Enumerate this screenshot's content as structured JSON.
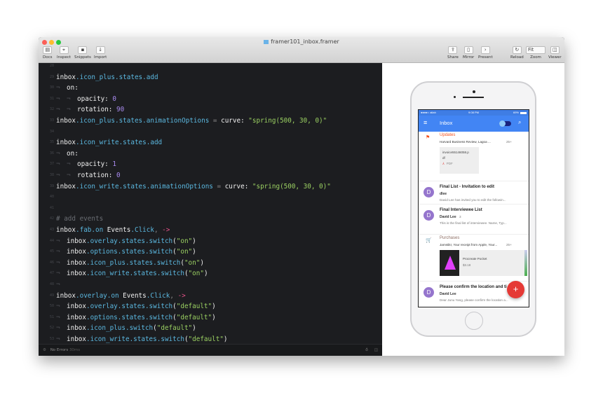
{
  "window": {
    "title": "framer101_inbox.framer"
  },
  "toolbar": {
    "left": [
      {
        "label": "Docs",
        "icon": "book-icon",
        "glyph": "▤"
      },
      {
        "label": "Inspect",
        "icon": "crosshair-icon",
        "glyph": "⌖"
      },
      {
        "label": "Snippets",
        "icon": "snippet-icon",
        "glyph": "▪"
      },
      {
        "label": "Import",
        "icon": "import-icon",
        "glyph": "↓"
      }
    ],
    "right": [
      {
        "label": "Share",
        "icon": "share-icon",
        "glyph": "⇪"
      },
      {
        "label": "Mirror",
        "icon": "mirror-icon",
        "glyph": "▯"
      },
      {
        "label": "Present",
        "icon": "present-icon",
        "glyph": "›"
      }
    ],
    "far": [
      {
        "label": "Reload",
        "icon": "reload-icon",
        "glyph": "↻"
      },
      {
        "label": "Zoom",
        "value": "Fit",
        "icon": "chevron-down-icon"
      },
      {
        "label": "Viewer",
        "icon": "viewer-icon",
        "glyph": "◫"
      }
    ]
  },
  "code": {
    "tab_glyph": "¬",
    "lines": [
      {
        "n": "28",
        "indent": 0,
        "t": []
      },
      {
        "n": "29",
        "indent": 0,
        "t": [
          [
            "inbox",
            "w"
          ],
          [
            ".icon_plus.states.add",
            "p"
          ]
        ]
      },
      {
        "n": "30",
        "indent": 1,
        "t": [
          [
            "on:",
            "w"
          ]
        ]
      },
      {
        "n": "31",
        "indent": 2,
        "t": [
          [
            "opacity: ",
            "w"
          ],
          [
            "0",
            "n"
          ]
        ]
      },
      {
        "n": "32",
        "indent": 2,
        "t": [
          [
            "rotation: ",
            "w"
          ],
          [
            "90",
            "n"
          ]
        ]
      },
      {
        "n": "33",
        "indent": 0,
        "t": [
          [
            "inbox",
            "w"
          ],
          [
            ".icon_plus.states.animationOptions",
            "p"
          ],
          [
            " = ",
            "o"
          ],
          [
            "curve: ",
            "w"
          ],
          [
            "\"spring(500, 30, 0)\"",
            "s"
          ]
        ]
      },
      {
        "n": "34",
        "indent": 0,
        "t": []
      },
      {
        "n": "35",
        "indent": 0,
        "t": [
          [
            "inbox",
            "w"
          ],
          [
            ".icon_write.states.add",
            "p"
          ]
        ]
      },
      {
        "n": "36",
        "indent": 1,
        "t": [
          [
            "on:",
            "w"
          ]
        ]
      },
      {
        "n": "37",
        "indent": 2,
        "t": [
          [
            "opacity: ",
            "w"
          ],
          [
            "1",
            "n"
          ]
        ]
      },
      {
        "n": "38",
        "indent": 2,
        "t": [
          [
            "rotation: ",
            "w"
          ],
          [
            "0",
            "n"
          ]
        ]
      },
      {
        "n": "39",
        "indent": 0,
        "t": [
          [
            "inbox",
            "w"
          ],
          [
            ".icon_write.states.animationOptions",
            "p"
          ],
          [
            " = ",
            "o"
          ],
          [
            "curve: ",
            "w"
          ],
          [
            "\"spring(500, 30, 0)\"",
            "s"
          ]
        ]
      },
      {
        "n": "40",
        "indent": 0,
        "t": []
      },
      {
        "n": "41",
        "indent": 0,
        "t": []
      },
      {
        "n": "42",
        "indent": 0,
        "t": [
          [
            "# add events",
            "c"
          ]
        ]
      },
      {
        "n": "43",
        "indent": 0,
        "t": [
          [
            "inbox",
            "w"
          ],
          [
            ".fab.on ",
            "p"
          ],
          [
            "Events",
            "w"
          ],
          [
            ".Click",
            "p"
          ],
          [
            ", ",
            "o"
          ],
          [
            "->",
            "k"
          ]
        ]
      },
      {
        "n": "44",
        "indent": 1,
        "t": [
          [
            "inbox",
            "w"
          ],
          [
            ".overlay.states.switch",
            "p"
          ],
          [
            "(",
            "w"
          ],
          [
            "\"on\"",
            "s"
          ],
          [
            ")",
            "w"
          ]
        ]
      },
      {
        "n": "45",
        "indent": 1,
        "t": [
          [
            "inbox",
            "w"
          ],
          [
            ".options.states.switch",
            "p"
          ],
          [
            "(",
            "w"
          ],
          [
            "\"on\"",
            "s"
          ],
          [
            ")",
            "w"
          ]
        ]
      },
      {
        "n": "46",
        "indent": 1,
        "t": [
          [
            "inbox",
            "w"
          ],
          [
            ".icon_plus.states.switch",
            "p"
          ],
          [
            "(",
            "w"
          ],
          [
            "\"on\"",
            "s"
          ],
          [
            ")",
            "w"
          ]
        ]
      },
      {
        "n": "47",
        "indent": 1,
        "t": [
          [
            "inbox",
            "w"
          ],
          [
            ".icon_write.states.switch",
            "p"
          ],
          [
            "(",
            "w"
          ],
          [
            "\"on\"",
            "s"
          ],
          [
            ")",
            "w"
          ]
        ]
      },
      {
        "n": "48",
        "indent": 1,
        "t": []
      },
      {
        "n": "49",
        "indent": 0,
        "t": [
          [
            "inbox",
            "w"
          ],
          [
            ".overlay.on ",
            "p"
          ],
          [
            "Events",
            "w"
          ],
          [
            ".Click",
            "p"
          ],
          [
            ", ",
            "o"
          ],
          [
            "->",
            "k"
          ]
        ]
      },
      {
        "n": "50",
        "indent": 1,
        "t": [
          [
            "inbox",
            "w"
          ],
          [
            ".overlay.states.switch",
            "p"
          ],
          [
            "(",
            "w"
          ],
          [
            "\"default\"",
            "s"
          ],
          [
            ")",
            "w"
          ]
        ]
      },
      {
        "n": "51",
        "indent": 1,
        "t": [
          [
            "inbox",
            "w"
          ],
          [
            ".options.states.switch",
            "p"
          ],
          [
            "(",
            "w"
          ],
          [
            "\"default\"",
            "s"
          ],
          [
            ")",
            "w"
          ]
        ]
      },
      {
        "n": "52",
        "indent": 1,
        "t": [
          [
            "inbox",
            "w"
          ],
          [
            ".icon_plus.switch",
            "p"
          ],
          [
            "(",
            "w"
          ],
          [
            "\"default\"",
            "s"
          ],
          [
            ")",
            "w"
          ]
        ]
      },
      {
        "n": "53",
        "indent": 1,
        "t": [
          [
            "inbox",
            "w"
          ],
          [
            ".icon_write.states.switch",
            "p"
          ],
          [
            "(",
            "w"
          ],
          [
            "\"default\"",
            "s"
          ],
          [
            ")",
            "w"
          ]
        ]
      }
    ]
  },
  "status": {
    "text": "No Errors",
    "time": "30ms"
  },
  "phone": {
    "statusbar": {
      "carrier": "●●●●○ atlah",
      "time": "9:08 PM",
      "battery": "69%"
    },
    "appbar": {
      "title": "Inbox"
    },
    "items": [
      {
        "kind": "bundle",
        "title": "Updates",
        "title_color": "#f4511e",
        "sub": "Harvard Business Review, Lagoa ...",
        "count": "25+",
        "attachment": {
          "name": "invoice55146058.p",
          "name2": "df",
          "type": "PDF"
        }
      },
      {
        "kind": "mail",
        "avatar": "D",
        "title": "Final List - Invitation to edit",
        "sender": "dlee",
        "snippet": "David Lee has invited you to edit the followin..."
      },
      {
        "kind": "mail",
        "avatar": "D",
        "title": "Final Interviewee List",
        "sender": "David Lee",
        "count": "3",
        "snippet": "This is the final list of interviewee. Name, Typ..."
      },
      {
        "kind": "bundle",
        "title": "Purchases",
        "title_color": "#8d6e63",
        "sub": "Jamstikr, Your receipt from Apple, Your...",
        "count": "25+",
        "card": {
          "name": "Procreate Pocket",
          "price": "$3.18"
        }
      },
      {
        "kind": "mail",
        "avatar": "D",
        "title": "Please confirm the location and ti",
        "sender": "David Lee",
        "snippet": "Dear Junu Yang, please confirm the location a..."
      }
    ],
    "fab": "+"
  },
  "colors": {
    "accent": "#4285f4",
    "fab": "#e53935",
    "avatar": "#9575cd"
  }
}
